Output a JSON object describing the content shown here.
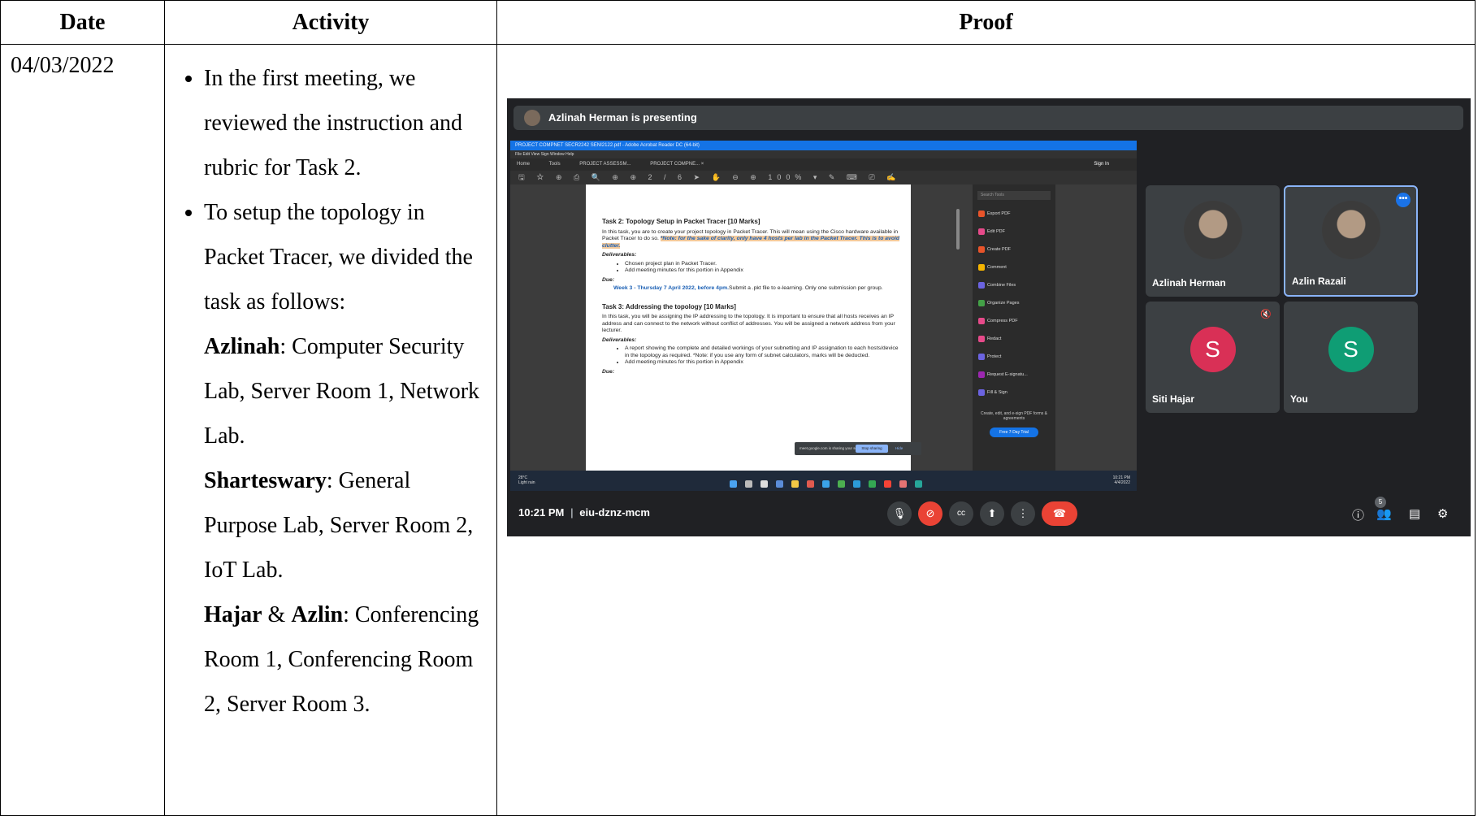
{
  "headers": {
    "date": "Date",
    "activity": "Activity",
    "proof": "Proof"
  },
  "row": {
    "date": "04/03/2022",
    "bullet1": "In the first meeting, we reviewed the instruction and rubric for Task 2.",
    "bullet2": "To setup the topology in Packet Tracer, we divided the task as follows:",
    "assign1_name": "Azlinah",
    "assign1_text": ": Computer Security Lab, Server Room 1, Network Lab.",
    "assign2_name": "Sharteswary",
    "assign2_text": ": General Purpose Lab, Server Room 2, IoT Lab.",
    "assign3_name_a": "Hajar",
    "assign3_amp": " & ",
    "assign3_name_b": "Azlin",
    "assign3_text": ": Conferencing Room 1, Conferencing Room 2, Server Room 3."
  },
  "meet": {
    "presenting": "Azlinah Herman is presenting",
    "time": "10:21 PM",
    "separator": "|",
    "code": "eiu-dznz-mcm",
    "tiles": [
      {
        "name": "Azlinah Herman"
      },
      {
        "name": "Azlin Razali"
      },
      {
        "name": "Siti Hajar",
        "initial": "S",
        "color": "#d93056"
      },
      {
        "name": "You",
        "initial": "S",
        "color": "#0f9d74"
      }
    ],
    "participant_count": "5",
    "controls": {
      "mic": "🎙",
      "cam_off": "⊘",
      "cc": "cc",
      "present": "⬆",
      "more": "⋮",
      "end": "☎",
      "info": "ⓘ",
      "people": "👥",
      "chat": "▤",
      "activities": "⚙"
    },
    "more_glyph": "•••",
    "mute_glyph": "🔇"
  },
  "acrobat": {
    "title": "PROJECT COMPNET SECR2242 SENI2122.pdf - Adobe Acrobat Reader DC (64-bit)",
    "menu": "File  Edit  View  Sign  Window  Help",
    "tabs": [
      "Home",
      "Tools",
      "PROJECT ASSESSM...",
      "PROJECT COMPNE... ×"
    ],
    "sign_in": "Sign In",
    "toolbar": "🖫 ☆ ⊕ ⎙ 🔍  ⊕ ⊕ 2 / 6  ➤ ✋ ⊖ ⊕ 100% ▾  ✎ ⌨ ⎚ ✍",
    "search": "Search Tools",
    "tools": [
      {
        "label": "Export PDF",
        "color": "#e8542a"
      },
      {
        "label": "Edit PDF",
        "color": "#e64a8a"
      },
      {
        "label": "Create PDF",
        "color": "#e8542a"
      },
      {
        "label": "Comment",
        "color": "#f5b400"
      },
      {
        "label": "Combine Files",
        "color": "#6b63e0"
      },
      {
        "label": "Organize Pages",
        "color": "#43a047"
      },
      {
        "label": "Compress PDF",
        "color": "#e64a8a"
      },
      {
        "label": "Redact",
        "color": "#e64a8a"
      },
      {
        "label": "Protect",
        "color": "#6b63e0"
      },
      {
        "label": "Request E-signatu...",
        "color": "#9c27b0"
      },
      {
        "label": "Fill & Sign",
        "color": "#6b63e0"
      }
    ],
    "promo": "Create, edit, and e-sign PDF forms & agreements",
    "trial": "Free 7-Day Trial",
    "weather_temp": "28°C",
    "weather_desc": "Light rain",
    "clock_time": "10:21 PM",
    "clock_date": "4/4/2022",
    "share_msg": "meet.google.com is sharing your screen.",
    "stop": "Stop sharing",
    "hide": "Hide"
  },
  "doc": {
    "task2_title": "Task 2: Topology Setup in Packet Tracer [10 Marks]",
    "task2_body": "In this task, you are to create your project topology in Packet Tracer. This will mean using the Cisco hardware available in Packet Tracer to do so.",
    "task2_note": "*Note: for the sake of clarity, only have 4 hosts per lab in the Packet Tracer. This is to avoid clutter.",
    "deliverables": "Deliverables:",
    "task2_d1": "Chosen project plan in Packet Tracer.",
    "task2_d2": "Add meeting minutes for this portion in Appendix",
    "due": "Due:",
    "task2_due_date": "Week 3 - Thursday 7 April 2022, before 4pm.",
    "task2_due_rest": "Submit a .pkt file to e-learning. Only one submission per group.",
    "task3_title": "Task 3: Addressing the topology [10 Marks]",
    "task3_body": "In this task, you will be assigning the IP addressing to the topology. It is important to ensure that all hosts receives an IP address and can connect to the network without conflict of addresses. You will be assigned a network address from your lecturer.",
    "task3_d1": "A report showing the complete and detailed workings of your subnetting and IP assignation to each hosts/device in the topology as required. *Note: if you use any form of subnet calculators, marks will be deducted.",
    "task3_d2": "Add meeting minutes for this portion in Appendix"
  }
}
